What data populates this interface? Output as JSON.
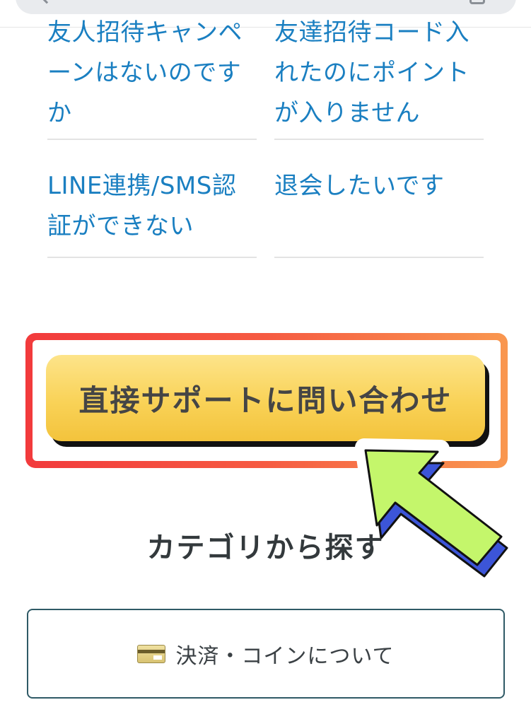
{
  "faq": {
    "items": [
      {
        "label": "友人招待キャンペ\nーンはないのです\nか"
      },
      {
        "label": "友達招待コード入\nれたのにポイント\nが入りません"
      },
      {
        "label": "LINE連携/SMS認\n証ができない"
      },
      {
        "label": "退会したいです"
      }
    ]
  },
  "cta": {
    "label": "直接サポートに問い合わせ"
  },
  "categories": {
    "title": "カテゴリから探す",
    "items": [
      {
        "label": "決済・コインについて",
        "icon": "credit-card-icon"
      }
    ]
  },
  "colors": {
    "link": "#1a7fc1",
    "cta_fill": "#f9d257",
    "highlight_start": "#f23a3c",
    "highlight_end": "#f9974f",
    "arrow_fill": "#c4f66b",
    "arrow_shadow": "#3c55d8"
  }
}
